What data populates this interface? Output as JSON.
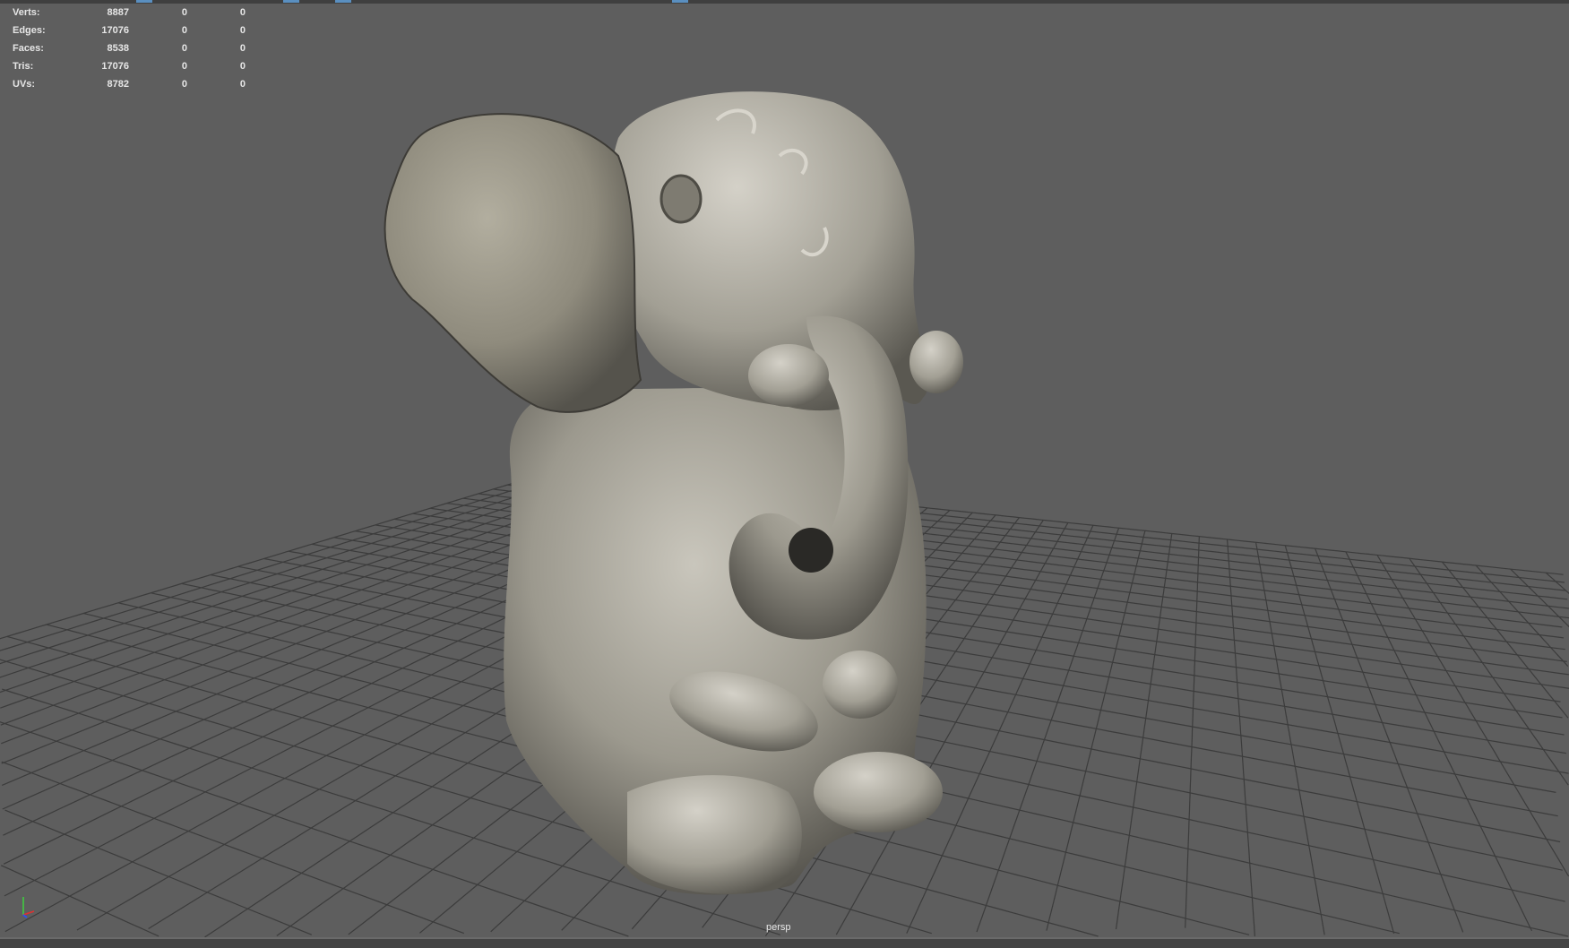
{
  "hud": {
    "rows": [
      {
        "label": "Verts:",
        "value": "8887",
        "sel": "0",
        "uv": "0"
      },
      {
        "label": "Edges:",
        "value": "17076",
        "sel": "0",
        "uv": "0"
      },
      {
        "label": "Faces:",
        "value": "8538",
        "sel": "0",
        "uv": "0"
      },
      {
        "label": "Tris:",
        "value": "17076",
        "sel": "0",
        "uv": "0"
      },
      {
        "label": "UVs:",
        "value": "8782",
        "sel": "0",
        "uv": "0"
      }
    ]
  },
  "viewport": {
    "camera_label": "persp",
    "background": "#5e5e5e",
    "grid_color": "#3c3c3c"
  },
  "axis": {
    "x": "x",
    "y": "y",
    "z": "z"
  }
}
